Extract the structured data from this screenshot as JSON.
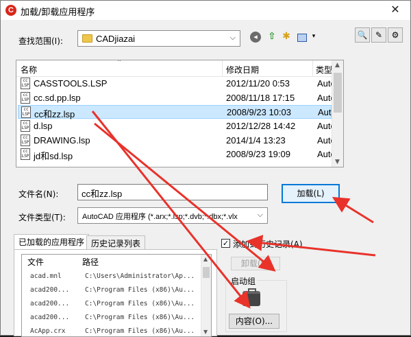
{
  "window": {
    "title": "加载/卸载应用程序",
    "app_icon_letter": "C",
    "close_glyph": "✕"
  },
  "look_in": {
    "label": "查找范围(I):",
    "value": "CADjiazai"
  },
  "toolbar_icons": [
    "back-icon",
    "up-folder-icon",
    "new-folder-icon",
    "view-menu-icon"
  ],
  "right_buttons": [
    "search-icon",
    "options-icon",
    "tools-icon"
  ],
  "file_list": {
    "columns": [
      "名称",
      "修改日期",
      "类型"
    ],
    "rows": [
      {
        "name": "CASSTOOLS.LSP",
        "date": "2012/11/20 0:53",
        "type": "Auto"
      },
      {
        "name": "cc.sd.pp.lsp",
        "date": "2008/11/18 17:15",
        "type": "Auto"
      },
      {
        "name": "cc和zz.lsp",
        "date": "2008/9/23 10:03",
        "type": "Auto",
        "selected": true
      },
      {
        "name": "d.lsp",
        "date": "2012/12/28 14:42",
        "type": "Auto"
      },
      {
        "name": "DRAWING.lsp",
        "date": "2014/1/4 13:23",
        "type": "Auto"
      },
      {
        "name": "jd和sd.lsp",
        "date": "2008/9/23 19:09",
        "type": "Auto"
      }
    ],
    "icon_text": "cc\nLSP"
  },
  "filename": {
    "label": "文件名(N):",
    "value": "cc和zz.lsp"
  },
  "filetype": {
    "label": "文件类型(T):",
    "value": "AutoCAD 应用程序 (*.arx;*.lsp;*.dvb;*.dbx;*.vlx"
  },
  "load_button": "加载(L)",
  "tabs": {
    "loaded": "已加载的应用程序",
    "history": "历史记录列表"
  },
  "loaded_list": {
    "columns": [
      "文件",
      "路径"
    ],
    "rows": [
      {
        "file": "acad.mnl",
        "path": "C:\\Users\\Administrator\\Ap..."
      },
      {
        "file": "acad200...",
        "path": "C:\\Program Files (x86)\\Au..."
      },
      {
        "file": "acad200...",
        "path": "C:\\Program Files (x86)\\Au..."
      },
      {
        "file": "acad200...",
        "path": "C:\\Program Files (x86)\\Au..."
      },
      {
        "file": "AcApp.crx",
        "path": "C:\\Program Files (x86)\\Au..."
      }
    ]
  },
  "history_checkbox": {
    "label": "添加到历史记录(A)",
    "checked": true
  },
  "unload_button": "卸载(U)",
  "startup_group": {
    "title": "启动组",
    "contents_button": "内容(O)..."
  },
  "annotation_color": "#e8322a"
}
